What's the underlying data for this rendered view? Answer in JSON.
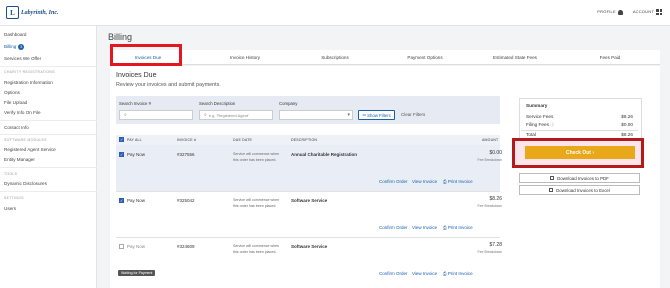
{
  "header": {
    "logo_mark": "L",
    "logo_text": "Labyrinth, Inc.",
    "profile_label": "PROFILE",
    "account_label": "ACCOUNT"
  },
  "sidebar": {
    "items": [
      {
        "label": "Dashboard"
      },
      {
        "label": "Billing",
        "badge": "3"
      },
      {
        "label": "Services We Offer"
      }
    ],
    "sections": [
      {
        "heading": "CHARITY REGISTRATIONS",
        "items": [
          "Registration Information",
          "Options",
          "File Upload",
          "Verify Info On File"
        ]
      },
      {
        "heading": "",
        "items": [
          "Contact Info"
        ]
      },
      {
        "heading": "SOFTWARE MODULES",
        "items": [
          "Registered Agent Service",
          "Entity Manager"
        ]
      },
      {
        "heading": "TOOLS",
        "items": [
          "Dynamic Disclosures"
        ]
      },
      {
        "heading": "SETTINGS",
        "items": [
          "Users"
        ]
      }
    ]
  },
  "page": {
    "title": "Billing"
  },
  "tabs": [
    {
      "label": "Invoices Due",
      "active": true
    },
    {
      "label": "Invoice History"
    },
    {
      "label": "Subscriptions"
    },
    {
      "label": "Payment Options"
    },
    {
      "label": "Estimated State Fees"
    },
    {
      "label": "Fees Paid"
    }
  ],
  "invoices": {
    "heading": "Invoices Due",
    "subheading": "Review your invoices and submit payments.",
    "filters": {
      "search_invoice_label": "Search Invoice #",
      "search_description_label": "Search Description",
      "search_description_placeholder": "e.g. 'Registered Agent'",
      "company_label": "Company",
      "show_filters_label": "Show Filters",
      "clear_filters_label": "Clear Filters"
    },
    "columns": {
      "pay_all": "PAY ALL",
      "invoice": "INVOICE #",
      "due_date": "DUE DATE",
      "description": "DESCRIPTION",
      "amount": "AMOUNT"
    },
    "rows": [
      {
        "pay_label": "Pay Now",
        "checked": true,
        "invoice": "#327556",
        "due_date": "Service will commence when this order has been placed.",
        "description": "Annual Charitable Registration",
        "amount": "$0.00",
        "fee_breakdown": "Fee Breakdown",
        "actions": [
          "Confirm Order",
          "View Invoice",
          "Print Invoice"
        ]
      },
      {
        "pay_label": "Pay Now",
        "checked": true,
        "invoice": "#325042",
        "due_date": "Service will commence when this order has been placed.",
        "description": "Software Service",
        "amount": "$8.26",
        "fee_breakdown": "Fee Breakdown",
        "actions": [
          "Confirm Order",
          "View Invoice",
          "Print Invoice"
        ]
      },
      {
        "pay_label": "Pay Now",
        "checked": false,
        "invoice": "#324609",
        "due_date": "Service will commence when this order has been placed.",
        "description": "Software Service",
        "amount": "$7.28",
        "fee_breakdown": "Fee Breakdown",
        "actions": [
          "Confirm Order",
          "View Invoice",
          "Print Invoice"
        ],
        "status_badge": "Waiting for Payment"
      }
    ]
  },
  "summary": {
    "title": "Summary",
    "service_fees_label": "Service Fees",
    "service_fees_value": "$8.26",
    "filing_fees_label": "Filing Fees",
    "filing_fees_value": "$0.00",
    "total_label": "Total",
    "total_value": "$8.26",
    "checkout_label": "Check Out",
    "download_pdf_label": "Download Invoices to PDF",
    "download_excel_label": "Download Invoices to Excel"
  },
  "colors": {
    "accent": "#1a5fa8",
    "checkout": "#e9a71a",
    "highlight_red": "#e4161e"
  }
}
